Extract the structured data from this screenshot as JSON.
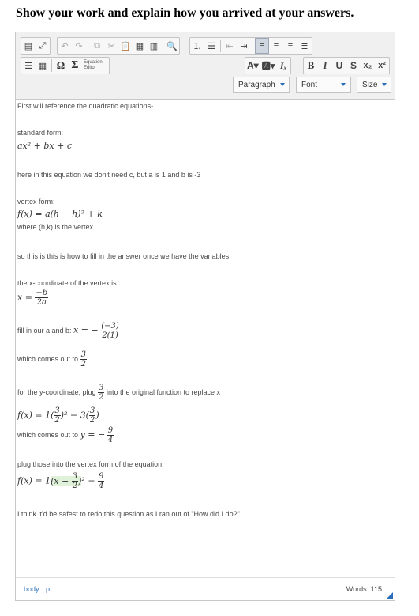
{
  "prompt": "Show your work and explain how you arrived at your answers.",
  "toolbar": {
    "equation_editor": "Equation Editor",
    "paragraph": "Paragraph",
    "font": "Font",
    "size": "Size",
    "bold": "B",
    "italic": "I",
    "underline": "U",
    "strike": "S",
    "subscript": "x₂",
    "superscript": "x²",
    "accent_color": "#2a6ebb"
  },
  "content": {
    "l1": "First will reference the quadratic equations-",
    "l2": "standard form:",
    "l3_math": "ax² + bx + c",
    "l4": "here in this equation we don't need c, but a is 1 and b is -3",
    "l5": "vertex form:",
    "l6_math": "f(x) = a(h − h)² + k",
    "l7": "where (h,k) is the vertex",
    "l8": "so this is this is how to fill in the answer once we have the variables.",
    "l9": "the x-coordinate of the vertex is",
    "l10_lhs": "x =",
    "l10_num": "−b",
    "l10_den": "2a",
    "l11_text": "fill in our a and b:",
    "l11_lhs": "x = −",
    "l11_num": "(−3)",
    "l11_den": "2(1)",
    "l12_text": "which comes out to",
    "l12_num": "3",
    "l12_den": "2",
    "l13_text": "for the y-coordinate, plug",
    "l13_num": "3",
    "l13_den": "2",
    "l13_tail": "into the original function to replace x",
    "l14_a": "f(x) = 1(",
    "l14_num1": "3",
    "l14_den1": "2",
    "l14_b": ")² − 3(",
    "l14_num2": "3",
    "l14_den2": "2",
    "l14_c": ")",
    "l15_text": "which comes out to",
    "l15_math": "y = −",
    "l15_num": "9",
    "l15_den": "4",
    "l16": "plug those into the vertex form of the equation:",
    "l17_a": "f(x) = 1",
    "l17_b": "(x −",
    "l17_num": "3",
    "l17_den": "2",
    "l17_c": ")",
    "l17_d": "² −",
    "l17_num2": "9",
    "l17_den2": "4",
    "l18": "I think it'd be safest to redo this question as I ran out of \"How did I do?\" ..."
  },
  "status": {
    "path_body": "body",
    "path_p": "p",
    "words": "Words: 115"
  }
}
